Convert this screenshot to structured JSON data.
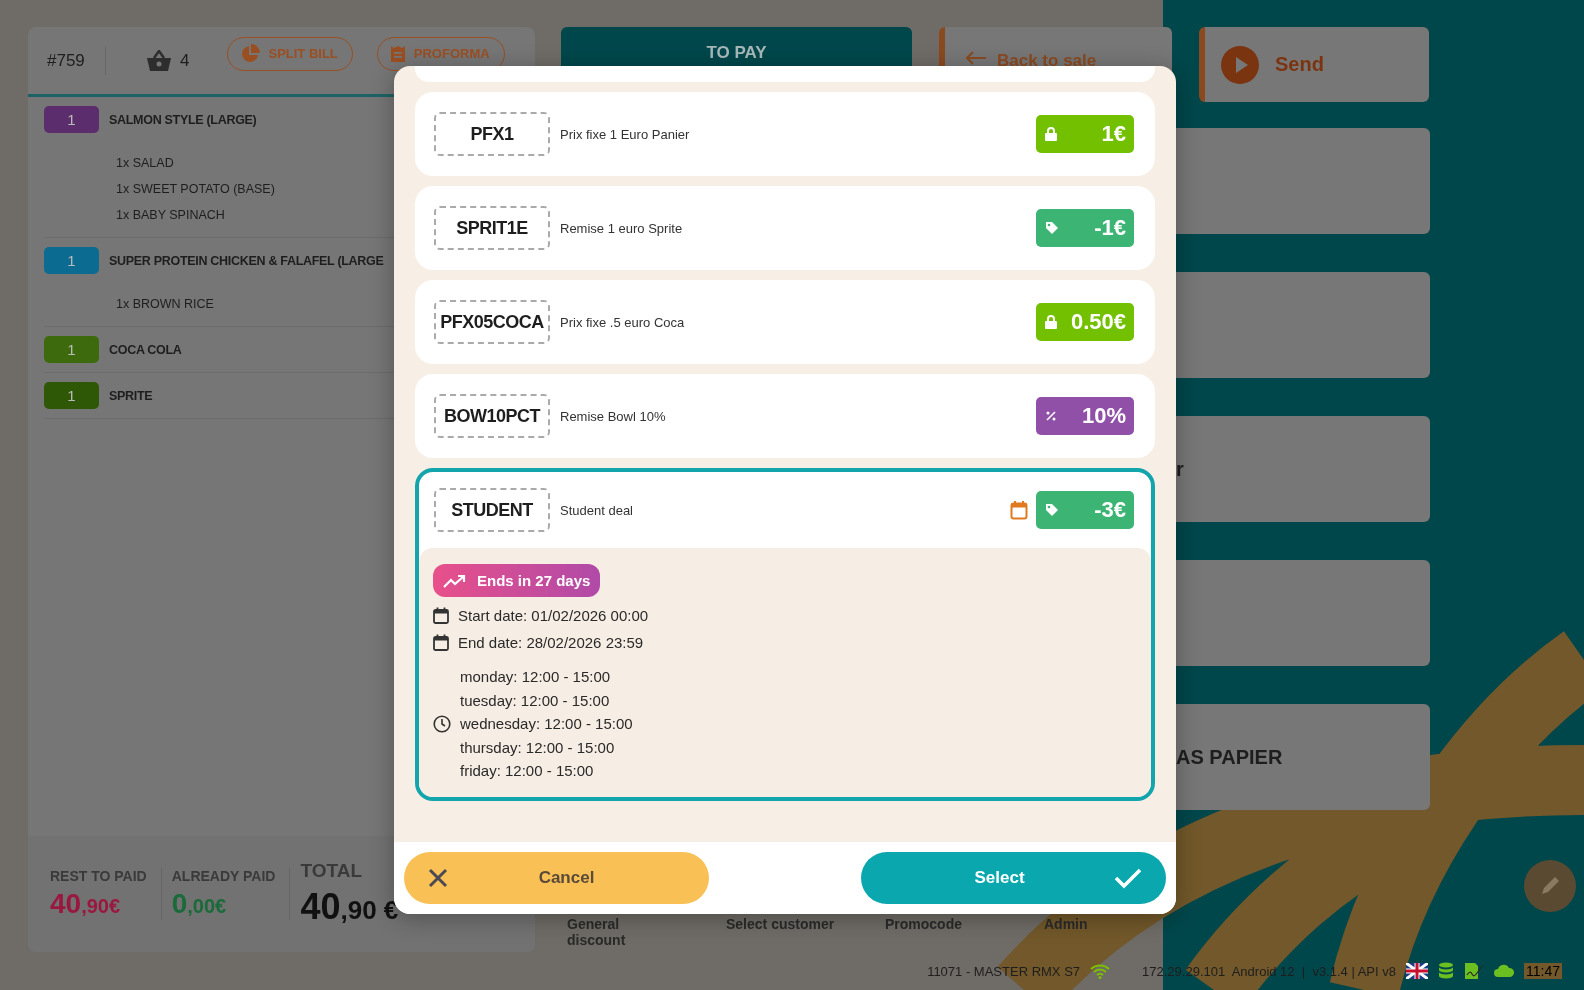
{
  "order": {
    "number": "#759",
    "item_count": "4",
    "buttons": [
      {
        "label": "SPLIT BILL",
        "kind": "split"
      },
      {
        "label": "PROFORMA",
        "kind": "proforma"
      }
    ],
    "lines": [
      {
        "qty": "1",
        "name": "SALMON STYLE (LARGE)",
        "color": "#5b2d6c",
        "modifiers": [
          "1x SALAD",
          "1x SWEET POTATO (BASE)",
          "1x BABY SPINACH"
        ]
      },
      {
        "qty": "1",
        "name": "SUPER PROTEIN CHICKEN & FALAFEL (LARGE",
        "color": "#0b6b90",
        "modifiers": [
          "1x BROWN RICE"
        ]
      },
      {
        "qty": "1",
        "name": "COCA COLA",
        "color": "#3c6a0c"
      },
      {
        "qty": "1",
        "name": "SPRITE",
        "color": "#2f5806"
      }
    ],
    "totals": [
      {
        "kind": "due",
        "label": "REST TO PAID",
        "whole": "40",
        "cents": ",90€"
      },
      {
        "kind": "paid",
        "label": "ALREADY PAID",
        "whole": "0",
        "cents": ",00€"
      },
      {
        "kind": "total",
        "label": "TOTAL",
        "whole": "40",
        "cents": ",90 €"
      }
    ]
  },
  "actions": {
    "to_pay": "TO PAY",
    "back": "Back to sale",
    "send": "Send",
    "tiles": [
      {
        "kind": "blank"
      },
      {
        "kind": "blank"
      },
      {
        "kind": "labeled",
        "label": "r"
      },
      {
        "kind": "blank"
      },
      {
        "kind": "labeled",
        "label": "AS PAPIER"
      }
    ],
    "shortcuts": [
      "General discount",
      "Select customer",
      "Promocode",
      "Admin"
    ]
  },
  "promo_dialog": {
    "codes": [
      {
        "code": "PFX1",
        "description": "Prix fixe 1 Euro Panier",
        "value": "1€",
        "kind": "fixed",
        "scheduled": false,
        "selected": false
      },
      {
        "code": "SPRIT1E",
        "description": "Remise 1 euro Sprite",
        "value": "-1€",
        "kind": "discount",
        "scheduled": false,
        "selected": false
      },
      {
        "code": "PFX05COCA",
        "description": "Prix fixe .5 euro Coca",
        "value": "0.50€",
        "kind": "fixed",
        "scheduled": false,
        "selected": false
      },
      {
        "code": "BOW10PCT",
        "description": "Remise Bowl 10%",
        "value": "10%",
        "kind": "percent",
        "scheduled": false,
        "selected": false
      },
      {
        "code": "STUDENT",
        "description": "Student deal",
        "value": "-3€",
        "kind": "discount",
        "scheduled": true,
        "selected": true,
        "details": {
          "badge": "Ends in 27 days",
          "start": "Start date: 01/02/2026 00:00",
          "end": "End date: 28/02/2026 23:59",
          "hours": [
            "monday: 12:00 - 15:00",
            "tuesday: 12:00 - 15:00",
            "wednesday: 12:00 - 15:00",
            "thursday: 12:00 - 15:00",
            "friday: 12:00 - 15:00"
          ]
        }
      }
    ],
    "cancel": "Cancel",
    "select": "Select"
  },
  "status_bar": {
    "device": "11071 - MASTER RMX S7",
    "system": "172.29.29.101  Android 12  |  v3.1.4 | API v8",
    "time": "11:47"
  }
}
